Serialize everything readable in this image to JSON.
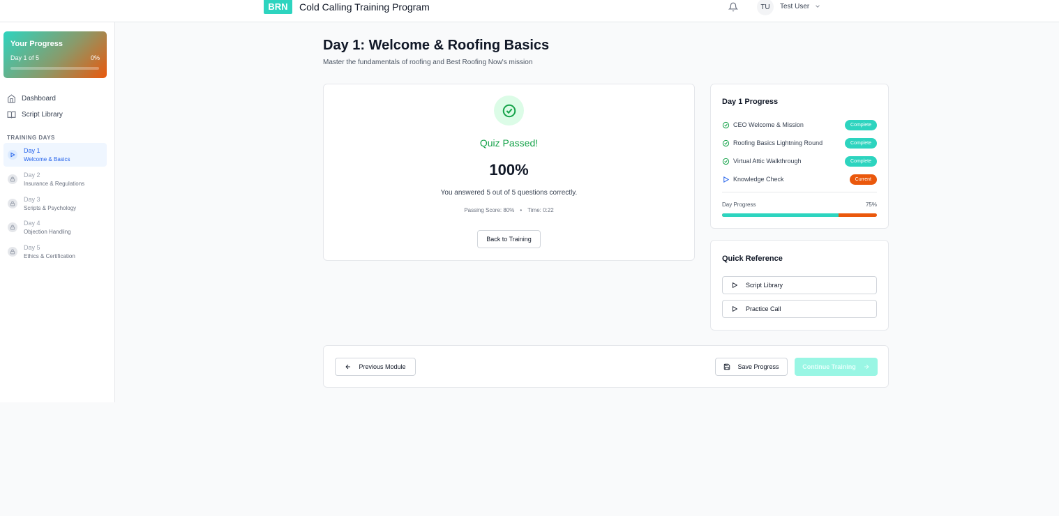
{
  "header": {
    "logo": "BRN",
    "title": "Cold Calling Training Program",
    "user_initials": "TU",
    "user_name": "Test User"
  },
  "sidebar": {
    "progress": {
      "title": "Your Progress",
      "day_label": "Day 1 of 5",
      "percent_label": "0%",
      "percent_value": 0
    },
    "nav": [
      {
        "label": "Dashboard",
        "icon": "home-icon"
      },
      {
        "label": "Script Library",
        "icon": "book-icon"
      }
    ],
    "section_label": "TRAINING DAYS",
    "days": [
      {
        "name": "Day 1",
        "sub": "Welcome & Basics",
        "state": "active"
      },
      {
        "name": "Day 2",
        "sub": "Insurance & Regulations",
        "state": "locked"
      },
      {
        "name": "Day 3",
        "sub": "Scripts & Psychology",
        "state": "locked"
      },
      {
        "name": "Day 4",
        "sub": "Objection Handling",
        "state": "locked"
      },
      {
        "name": "Day 5",
        "sub": "Ethics & Certification",
        "state": "locked"
      }
    ]
  },
  "main": {
    "title": "Day 1: Welcome & Roofing Basics",
    "subtitle": "Master the fundamentals of roofing and Best Roofing Now's mission",
    "quiz": {
      "status": "Quiz Passed!",
      "score": "100%",
      "result_text": "You answered 5 out of 5 questions correctly.",
      "passing_score": "Passing Score: 80%",
      "separator": "•",
      "time": "Time: 0:22",
      "back_button": "Back to Training"
    },
    "day_progress": {
      "title": "Day 1 Progress",
      "items": [
        {
          "label": "CEO Welcome & Mission",
          "status": "Complete",
          "icon": "check-circle-icon"
        },
        {
          "label": "Roofing Basics Lightning Round",
          "status": "Complete",
          "icon": "check-circle-icon"
        },
        {
          "label": "Virtual Attic Walkthrough",
          "status": "Complete",
          "icon": "check-circle-icon"
        },
        {
          "label": "Knowledge Check",
          "status": "Current",
          "icon": "play-icon"
        }
      ],
      "progress_label": "Day Progress",
      "progress_pct_label": "75%",
      "progress_value": 75
    },
    "quick_reference": {
      "title": "Quick Reference",
      "buttons": [
        "Script Library",
        "Practice Call"
      ]
    },
    "navigation": {
      "previous": "Previous Module",
      "save": "Save Progress",
      "continue": "Continue Training"
    }
  },
  "colors": {
    "accent_teal": "#2dd4bf",
    "accent_orange": "#ea580c",
    "success_green": "#16a34a",
    "active_blue": "#2563eb"
  }
}
